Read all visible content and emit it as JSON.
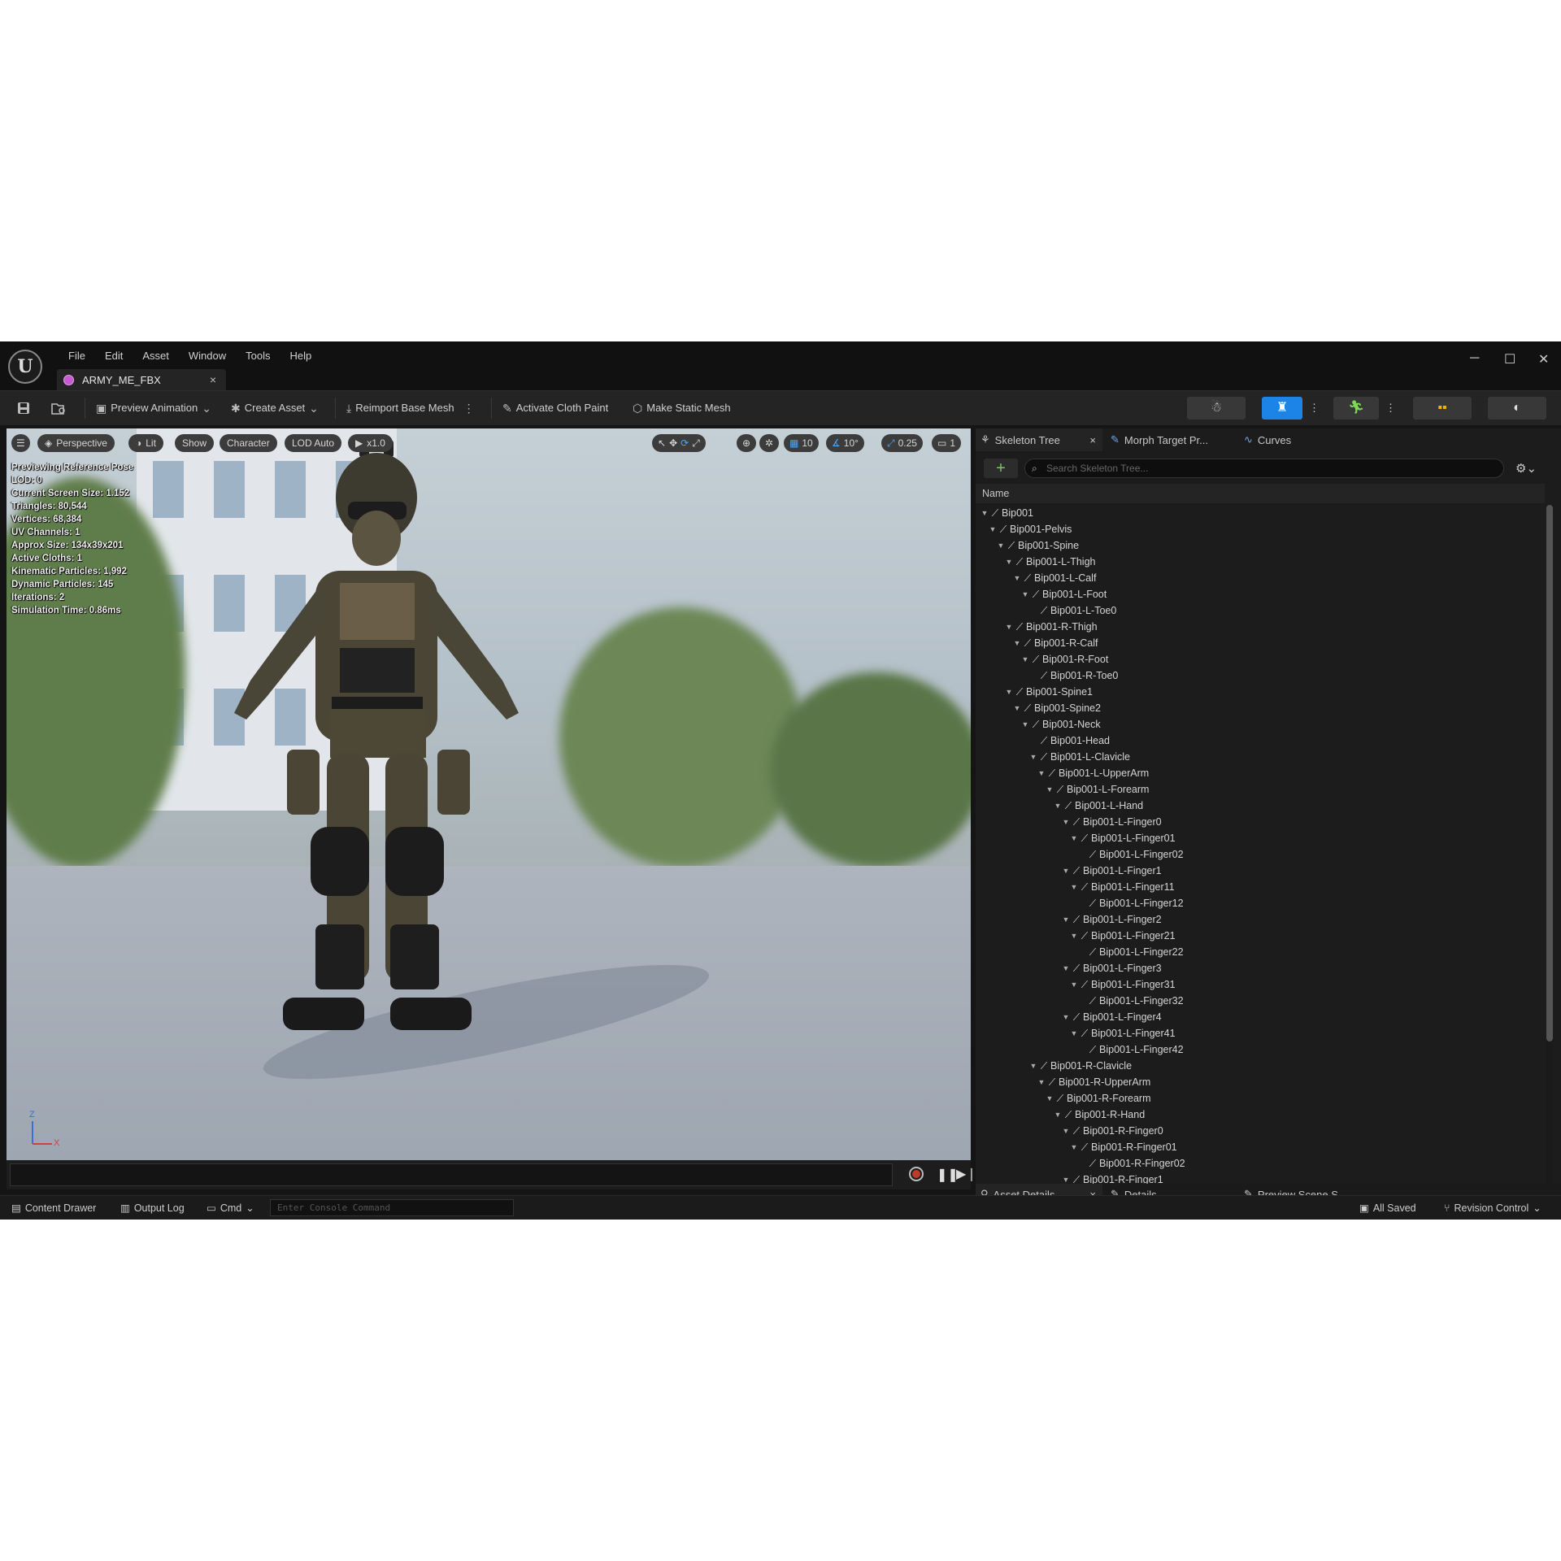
{
  "menu": [
    "File",
    "Edit",
    "Asset",
    "Window",
    "Tools",
    "Help"
  ],
  "doc_tab": {
    "title": "ARMY_ME_FBX",
    "close": "×"
  },
  "window_controls": {
    "minimize": "─",
    "maximize": "☐",
    "close": "✕"
  },
  "toolbar": {
    "preview_animation": "Preview Animation",
    "create_asset": "Create Asset",
    "reimport": "Reimport Base Mesh",
    "cloth_paint": "Activate Cloth Paint",
    "static_mesh": "Make Static Mesh"
  },
  "viewport": {
    "buttons": {
      "perspective": "Perspective",
      "lit": "Lit",
      "show": "Show",
      "character": "Character",
      "lod": "LOD Auto",
      "speed": "x1.0"
    },
    "right_buttons": {
      "grid": "10",
      "angle": "10°",
      "scale": "0.25",
      "camera": "1"
    },
    "stats": [
      "Previewing Reference Pose",
      "LOD: 0",
      "Current Screen Size: 1.152",
      "Triangles: 80,544",
      "Vertices: 68,384",
      "UV Channels: 1",
      "Approx Size: 134x39x201",
      "Active Cloths: 1",
      "Kinematic Particles: 1,992",
      "Dynamic Particles: 145",
      "Iterations: 2",
      "Simulation Time: 0.86ms"
    ],
    "axis": {
      "z": "Z",
      "x": "X"
    }
  },
  "right_panel": {
    "tabs": {
      "skeleton_tree": "Skeleton Tree",
      "morph": "Morph Target Pr...",
      "curves": "Curves"
    },
    "search_placeholder": "Search Skeleton Tree...",
    "column_header": "Name",
    "bones": [
      {
        "name": "Bip001",
        "depth": 0,
        "expanded": true
      },
      {
        "name": "Bip001-Pelvis",
        "depth": 1,
        "expanded": true
      },
      {
        "name": "Bip001-Spine",
        "depth": 2,
        "expanded": true
      },
      {
        "name": "Bip001-L-Thigh",
        "depth": 3,
        "expanded": true
      },
      {
        "name": "Bip001-L-Calf",
        "depth": 4,
        "expanded": true
      },
      {
        "name": "Bip001-L-Foot",
        "depth": 5,
        "expanded": true
      },
      {
        "name": "Bip001-L-Toe0",
        "depth": 6,
        "expanded": false
      },
      {
        "name": "Bip001-R-Thigh",
        "depth": 3,
        "expanded": true
      },
      {
        "name": "Bip001-R-Calf",
        "depth": 4,
        "expanded": true
      },
      {
        "name": "Bip001-R-Foot",
        "depth": 5,
        "expanded": true
      },
      {
        "name": "Bip001-R-Toe0",
        "depth": 6,
        "expanded": false
      },
      {
        "name": "Bip001-Spine1",
        "depth": 3,
        "expanded": true
      },
      {
        "name": "Bip001-Spine2",
        "depth": 4,
        "expanded": true
      },
      {
        "name": "Bip001-Neck",
        "depth": 5,
        "expanded": true
      },
      {
        "name": "Bip001-Head",
        "depth": 6,
        "expanded": false
      },
      {
        "name": "Bip001-L-Clavicle",
        "depth": 6,
        "expanded": true
      },
      {
        "name": "Bip001-L-UpperArm",
        "depth": 7,
        "expanded": true
      },
      {
        "name": "Bip001-L-Forearm",
        "depth": 8,
        "expanded": true
      },
      {
        "name": "Bip001-L-Hand",
        "depth": 9,
        "expanded": true
      },
      {
        "name": "Bip001-L-Finger0",
        "depth": 10,
        "expanded": true
      },
      {
        "name": "Bip001-L-Finger01",
        "depth": 11,
        "expanded": true
      },
      {
        "name": "Bip001-L-Finger02",
        "depth": 12,
        "expanded": false
      },
      {
        "name": "Bip001-L-Finger1",
        "depth": 10,
        "expanded": true
      },
      {
        "name": "Bip001-L-Finger11",
        "depth": 11,
        "expanded": true
      },
      {
        "name": "Bip001-L-Finger12",
        "depth": 12,
        "expanded": false
      },
      {
        "name": "Bip001-L-Finger2",
        "depth": 10,
        "expanded": true
      },
      {
        "name": "Bip001-L-Finger21",
        "depth": 11,
        "expanded": true
      },
      {
        "name": "Bip001-L-Finger22",
        "depth": 12,
        "expanded": false
      },
      {
        "name": "Bip001-L-Finger3",
        "depth": 10,
        "expanded": true
      },
      {
        "name": "Bip001-L-Finger31",
        "depth": 11,
        "expanded": true
      },
      {
        "name": "Bip001-L-Finger32",
        "depth": 12,
        "expanded": false
      },
      {
        "name": "Bip001-L-Finger4",
        "depth": 10,
        "expanded": true
      },
      {
        "name": "Bip001-L-Finger41",
        "depth": 11,
        "expanded": true
      },
      {
        "name": "Bip001-L-Finger42",
        "depth": 12,
        "expanded": false
      },
      {
        "name": "Bip001-R-Clavicle",
        "depth": 6,
        "expanded": true
      },
      {
        "name": "Bip001-R-UpperArm",
        "depth": 7,
        "expanded": true
      },
      {
        "name": "Bip001-R-Forearm",
        "depth": 8,
        "expanded": true
      },
      {
        "name": "Bip001-R-Hand",
        "depth": 9,
        "expanded": true
      },
      {
        "name": "Bip001-R-Finger0",
        "depth": 10,
        "expanded": true
      },
      {
        "name": "Bip001-R-Finger01",
        "depth": 11,
        "expanded": true
      },
      {
        "name": "Bip001-R-Finger02",
        "depth": 12,
        "expanded": false
      },
      {
        "name": "Bip001-R-Finger1",
        "depth": 10,
        "expanded": true
      }
    ],
    "bottom_tabs": {
      "asset_details": "Asset Details",
      "details": "Details",
      "preview_scene": "Preview Scene S..."
    }
  },
  "status_bar": {
    "content_drawer": "Content Drawer",
    "output_log": "Output Log",
    "cmd": "Cmd",
    "console_placeholder": "Enter Console Command",
    "all_saved": "All Saved",
    "revision_control": "Revision Control"
  },
  "icons": [
    "unreal-logo",
    "save-icon",
    "browse-icon",
    "skeleton-icon",
    "mesh-icon",
    "animation-icon",
    "blueprint-icon",
    "physics-icon",
    "search-icon",
    "settings-icon",
    "bone-icon",
    "record-icon",
    "pause-icon",
    "play-icon"
  ],
  "colors": {
    "accent": "#1b84e6",
    "add": "#6fcf4f",
    "record": "#c0392b"
  }
}
